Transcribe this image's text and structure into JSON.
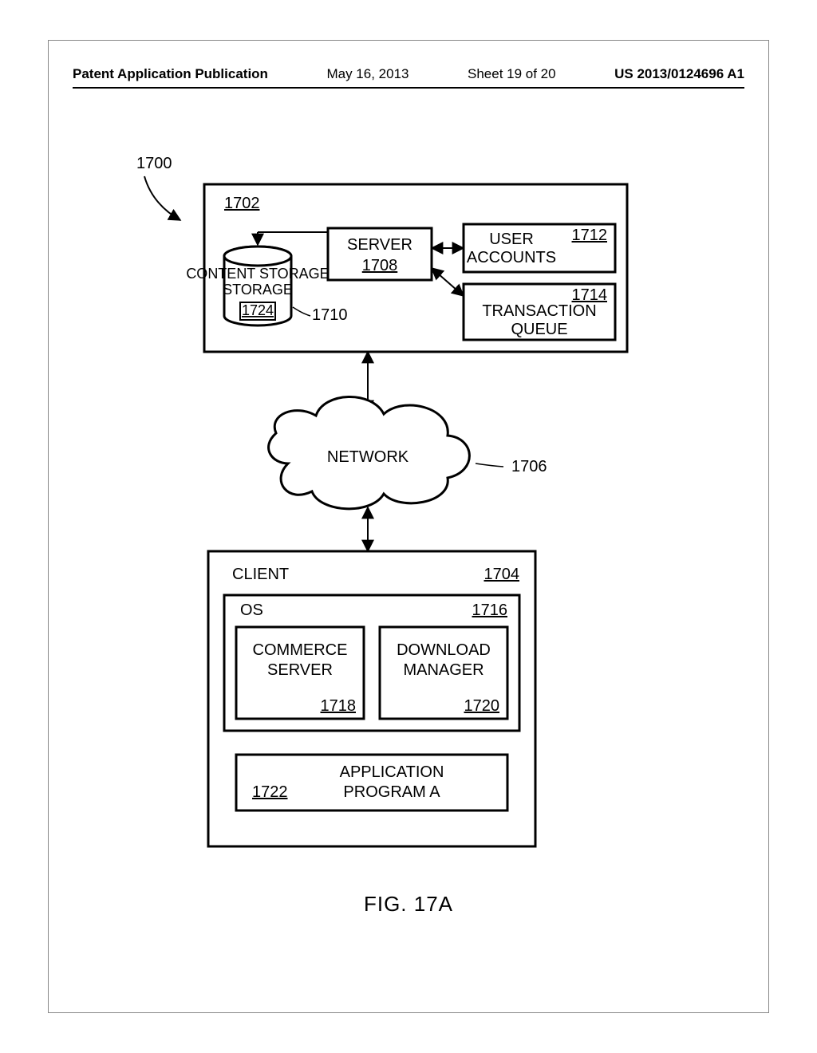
{
  "header": {
    "pub": "Patent Application Publication",
    "date": "May 16, 2013",
    "sheet": "Sheet 19 of 20",
    "docnum": "US 2013/0124696 A1"
  },
  "fig": {
    "caption": "FIG. 17A",
    "ref_main": "1700",
    "server_group": "1702",
    "server": "SERVER",
    "server_ref": "1708",
    "content_storage": "CONTENT STORAGE",
    "content_storage_ref": "1724",
    "content_storage_leader": "1710",
    "user_accounts": "USER ACCOUNTS",
    "user_accounts_ref": "1712",
    "txn_queue": "TRANSACTION QUEUE",
    "txn_queue_ref": "1714",
    "network": "NETWORK",
    "network_ref": "1706",
    "client": "CLIENT",
    "client_ref": "1704",
    "os": "OS",
    "os_ref": "1716",
    "commerce": "COMMERCE SERVER",
    "commerce_ref": "1718",
    "download": "DOWNLOAD MANAGER",
    "download_ref": "1720",
    "app": "APPLICATION PROGRAM A",
    "app_ref": "1722"
  }
}
